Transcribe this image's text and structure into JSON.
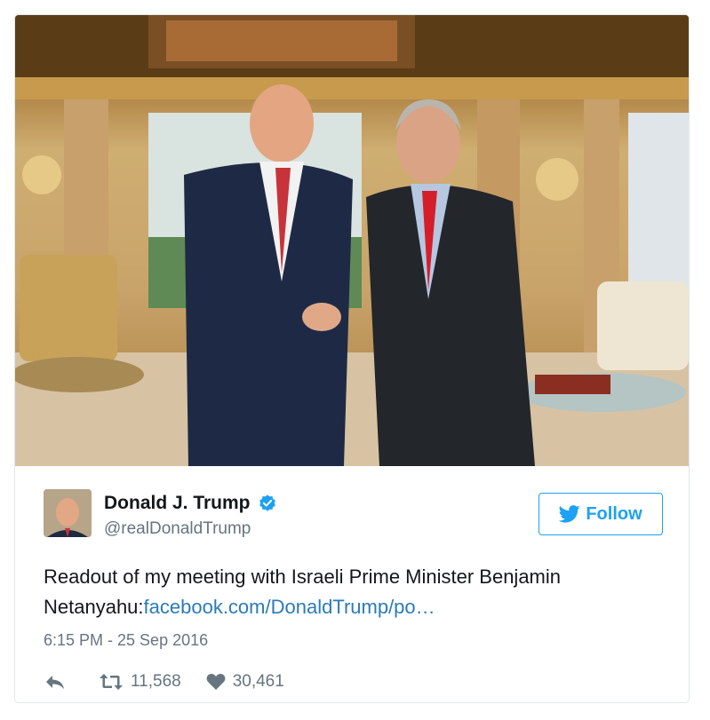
{
  "tweet": {
    "author_name": "Donald J. Trump",
    "author_handle": "@realDonaldTrump",
    "follow_label": "Follow",
    "text": "Readout of my meeting with Israeli Prime Minister Benjamin Netanyahu:",
    "link_text": "facebook.com/DonaldTrump/po…",
    "timestamp": "6:15 PM - 25 Sep 2016",
    "retweets": "11,568",
    "likes": "30,461"
  },
  "colors": {
    "accent": "#1da1f2",
    "link": "#2b7bb9",
    "muted": "#66757f"
  },
  "icons": [
    "verified-badge-icon",
    "twitter-bird-icon",
    "reply-icon",
    "retweet-icon",
    "heart-icon"
  ]
}
